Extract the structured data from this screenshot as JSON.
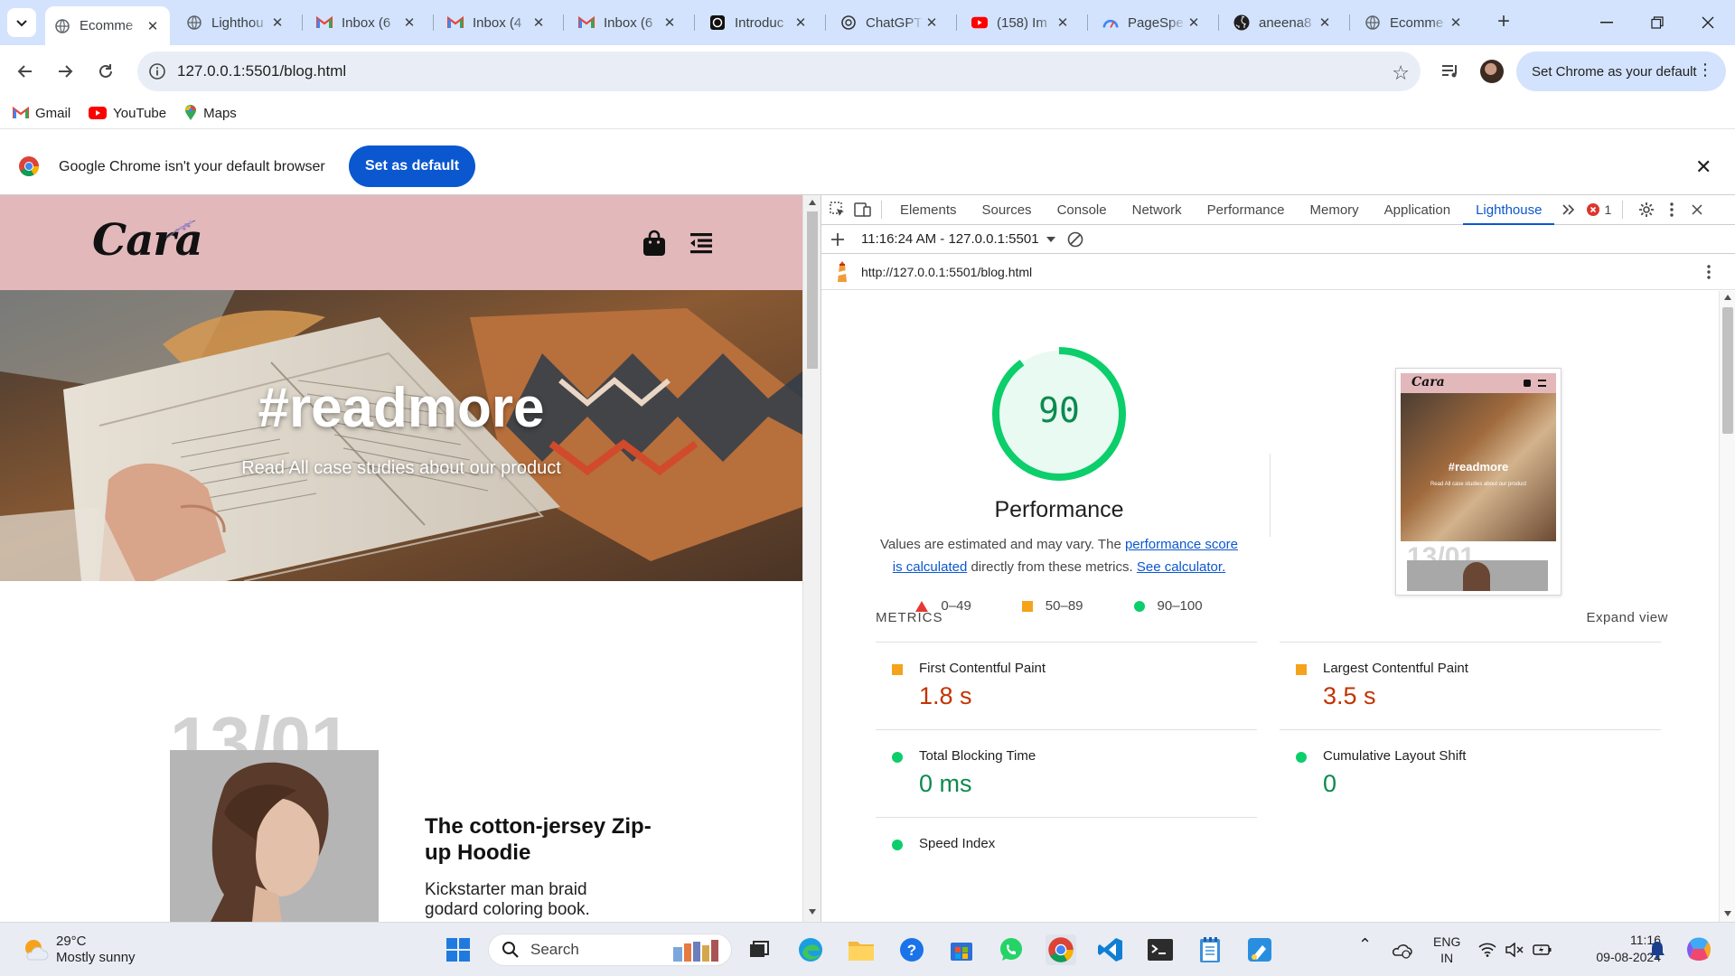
{
  "browser": {
    "tabs": [
      {
        "title": "Ecomme",
        "icon": "globe-icon",
        "active": true
      },
      {
        "title": "Lighthou",
        "icon": "globe-icon"
      },
      {
        "title": "Inbox (6",
        "icon": "gmail-icon"
      },
      {
        "title": "Inbox (4",
        "icon": "gmail-icon"
      },
      {
        "title": "Inbox (6",
        "icon": "gmail-icon"
      },
      {
        "title": "Introduc",
        "icon": "openai-icon"
      },
      {
        "title": "ChatGPT",
        "icon": "openai-icon"
      },
      {
        "title": "(158) Im",
        "icon": "youtube-icon"
      },
      {
        "title": "PageSpe",
        "icon": "pagespeed-icon"
      },
      {
        "title": "aneena8",
        "icon": "github-icon"
      },
      {
        "title": "Ecomme",
        "icon": "globe-icon"
      }
    ],
    "url": "127.0.0.1:5501/blog.html",
    "set_default_chip": "Set Chrome as your default",
    "bookmarks": [
      {
        "label": "Gmail",
        "icon": "gmail-icon"
      },
      {
        "label": "YouTube",
        "icon": "youtube-icon"
      },
      {
        "label": "Maps",
        "icon": "maps-icon"
      }
    ],
    "infobar": {
      "message": "Google Chrome isn't your default browser",
      "button": "Set as default"
    }
  },
  "page": {
    "logo": "Cara",
    "hero_title": "#readmore",
    "hero_subtitle": "Read All case studies about our product",
    "blog_date": "13/01",
    "blog_title": "The cotton-jersey Zip-up Hoodie",
    "blog_text": "Kickstarter man braid godard coloring book."
  },
  "devtools": {
    "tabs": [
      "Elements",
      "Sources",
      "Console",
      "Network",
      "Performance",
      "Memory",
      "Application",
      "Lighthouse"
    ],
    "active_tab": "Lighthouse",
    "error_count": "1",
    "report_selector": "11:16:24 AM - 127.0.0.1:5501",
    "report_url": "http://127.0.0.1:5501/blog.html",
    "lighthouse": {
      "score": "90",
      "score_fraction": 0.9,
      "category": "Performance",
      "desc_prefix": "Values are estimated and may vary. The ",
      "desc_link1": "performance score is calculated",
      "desc_middle": " directly from these metrics. ",
      "desc_link2": "See calculator.",
      "legend": [
        {
          "range": "0–49",
          "shape": "triangle",
          "color": "#e53935"
        },
        {
          "range": "50–89",
          "shape": "square",
          "color": "#f4a31b"
        },
        {
          "range": "90–100",
          "shape": "circle",
          "color": "#0cce6b"
        }
      ],
      "thumb": {
        "logo": "Cara",
        "hero_title": "#readmore",
        "hero_subtitle": "Read All case studies about our product",
        "date": "13/01"
      },
      "metrics_label": "METRICS",
      "expand_view": "Expand view",
      "metrics": [
        {
          "name": "First Contentful Paint",
          "value": "1.8 s",
          "rating": "average"
        },
        {
          "name": "Largest Contentful Paint",
          "value": "3.5 s",
          "rating": "average"
        },
        {
          "name": "Total Blocking Time",
          "value": "0 ms",
          "rating": "pass"
        },
        {
          "name": "Cumulative Layout Shift",
          "value": "0",
          "rating": "pass"
        },
        {
          "name": "Speed Index",
          "value": "",
          "rating": "pass"
        }
      ]
    }
  },
  "taskbar": {
    "weather_temp": "29°C",
    "weather_desc": "Mostly sunny",
    "search": "Search",
    "lang1": "ENG",
    "lang2": "IN",
    "time": "11:16",
    "date": "09-08-2024"
  },
  "colors": {
    "tabstrip": "#d3e3fd",
    "header_pink": "#e3b8bb",
    "accent_blue": "#0b57d0",
    "pass_green": "#0cce6b",
    "average_orange": "#f4a31b"
  }
}
